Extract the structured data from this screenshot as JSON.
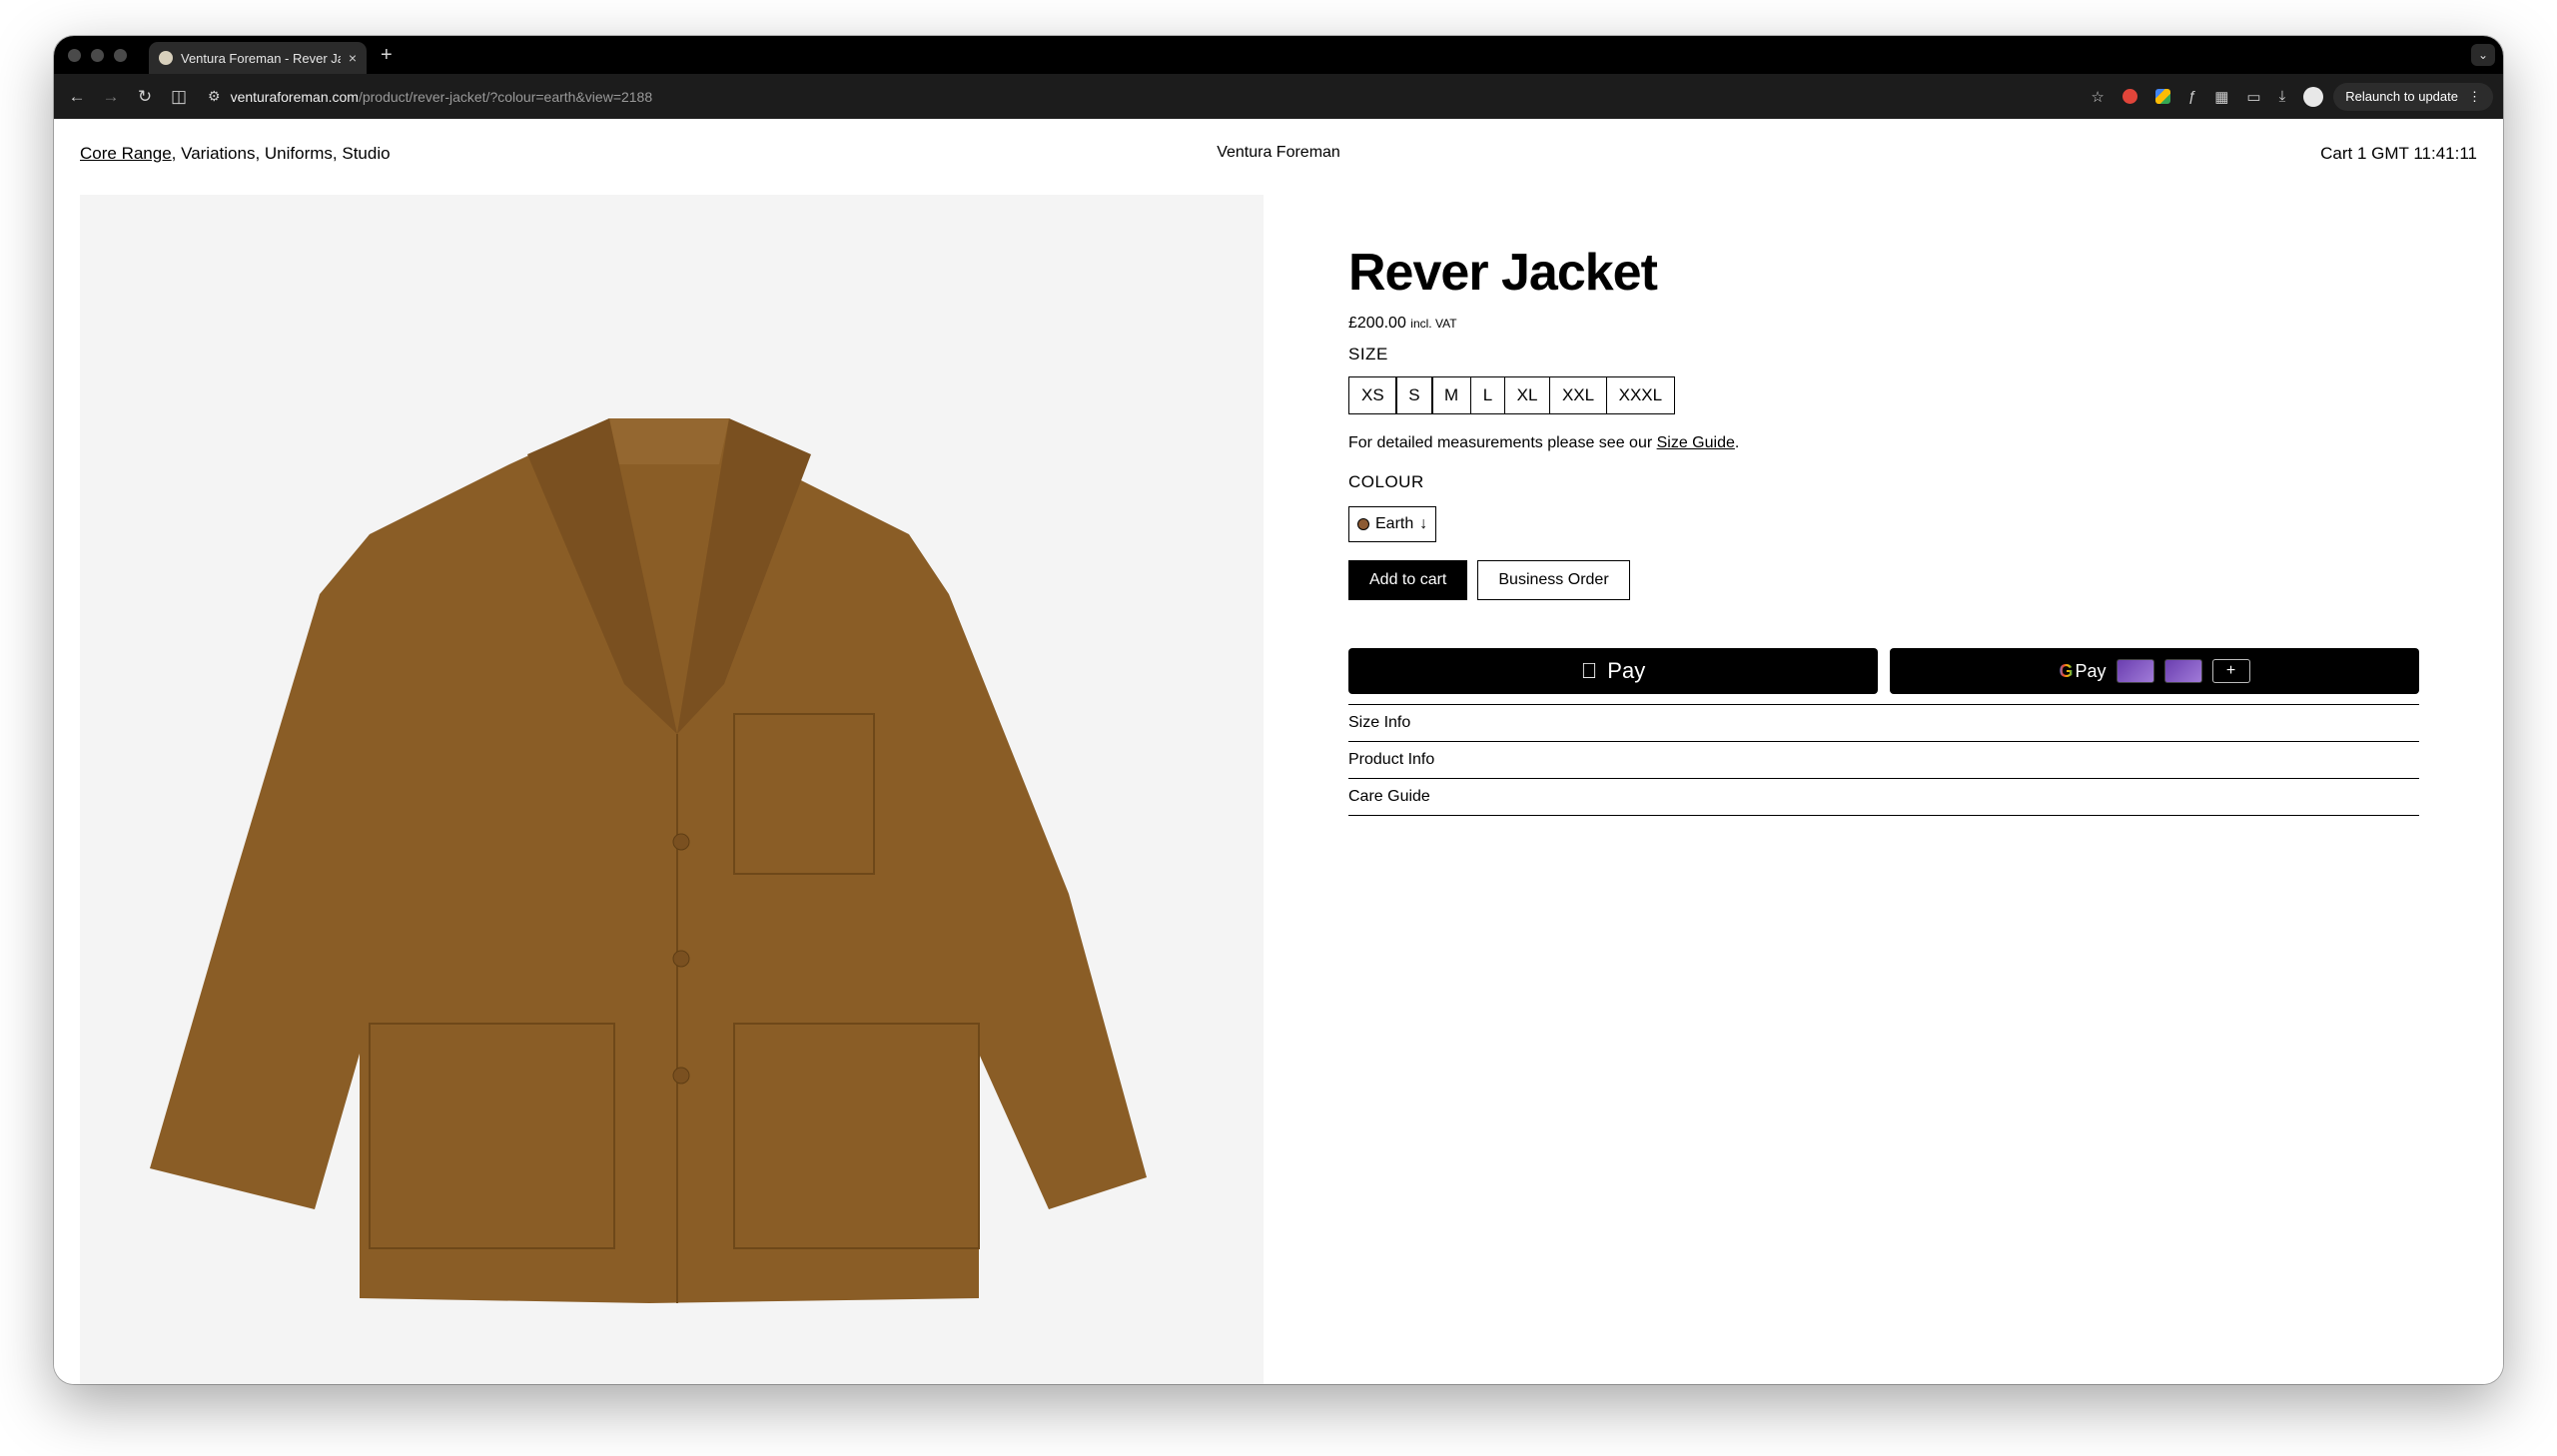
{
  "browser": {
    "tab_title": "Ventura Foreman - Rever Jacket",
    "new_tab_label": "+",
    "close_label": "×",
    "url_host": "venturaforeman.com",
    "url_path": "/product/rever-jacket/?colour=earth&view=2188",
    "relaunch_label": "Relaunch to update"
  },
  "site": {
    "nav_active": "Core Range",
    "nav_rest": ", Variations, Uniforms, Studio",
    "brand": "Ventura Foreman",
    "cart_clock": "Cart 1  GMT 11:41:11"
  },
  "product": {
    "title": "Rever Jacket",
    "price": "£200.00",
    "vat": "incl. VAT",
    "size_label": "SIZE",
    "sizes": [
      "XS",
      "S",
      "M",
      "L",
      "XL",
      "XXL",
      "XXXL"
    ],
    "measure_note_pre": "For detailed measurements please see our ",
    "measure_note_link": "Size Guide",
    "measure_note_post": ".",
    "colour_label": "COLOUR",
    "colour_value": "Earth",
    "colour_swatch": "#8c5a33",
    "add_to_cart": "Add to cart",
    "business_order": "Business Order",
    "apple_pay": "Pay",
    "google_pay": "Pay",
    "card_plus": "+",
    "accordion": [
      "Size Info",
      "Product Info",
      "Care Guide"
    ],
    "garment_color": "#8a5d26",
    "background_color": "#f4f4f4"
  }
}
